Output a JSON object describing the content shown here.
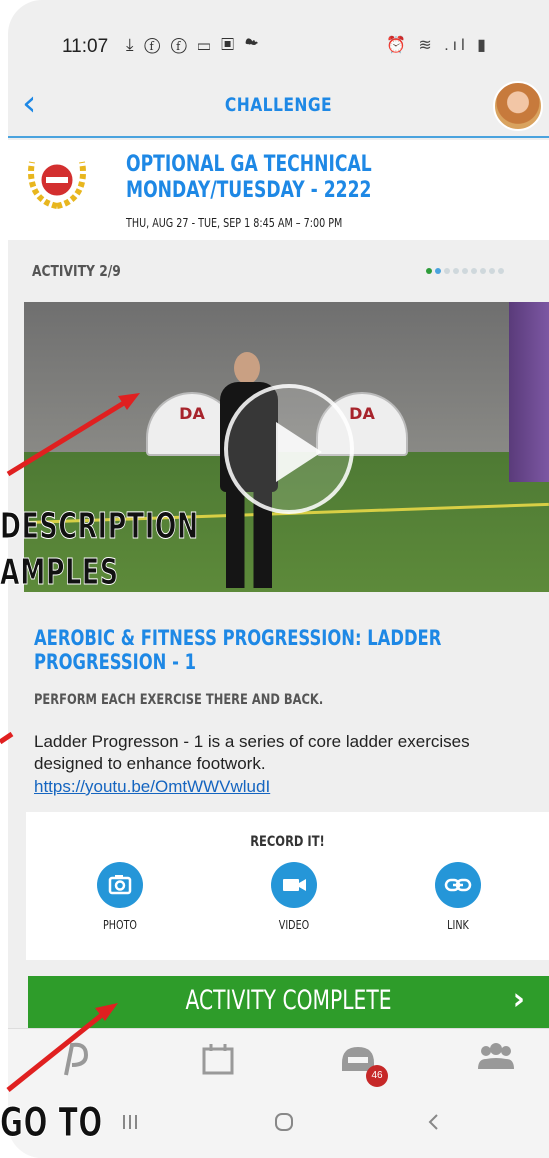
{
  "status_bar": {
    "time": "11:07",
    "left_icons": "⤓ ⓕ ⓕ ▭ ▣ ☁",
    "right_icons": "⏰ ≋ .ıl ▮"
  },
  "header": {
    "back_icon": "‹",
    "title": "CHALLENGE"
  },
  "challenge": {
    "title": "OPTIONAL GA TECHNICAL MONDAY/TUESDAY - 2222",
    "dates": "THU, AUG 27 - TUE, SEP 1 8:45 AM – 7:00 PM"
  },
  "activity": {
    "counter": "ACTIVITY 2/9",
    "pager": {
      "total": 9,
      "current": 1
    },
    "video_banner_text": "DA",
    "title": "AEROBIC & FITNESS PROGRESSION: LADDER PROGRESSION - 1",
    "subtitle": "PERFORM EACH EXERCISE THERE AND BACK.",
    "description": "Ladder Progresson - 1 is a series of core ladder exercises designed to enhance footwork.",
    "link": "https://youtu.be/OmtWWVwludI"
  },
  "record": {
    "title": "RECORD IT!",
    "options": [
      {
        "label": "PHOTO",
        "icon": "camera-icon"
      },
      {
        "label": "VIDEO",
        "icon": "video-camera-icon"
      },
      {
        "label": "LINK",
        "icon": "link-icon"
      }
    ]
  },
  "complete_button": {
    "label": "ACTIVITY COMPLETE",
    "chevron": "›"
  },
  "tab_bar": {
    "badge_count": "46"
  },
  "annotations": {
    "line1": "DESCRIPTION",
    "line2": "AMPLES",
    "line3": "GO TO"
  },
  "colors": {
    "accent": "#1e88e5",
    "complete_green": "#2e9c2a",
    "arrow_red": "#e02020",
    "badge_red": "#c62828"
  }
}
